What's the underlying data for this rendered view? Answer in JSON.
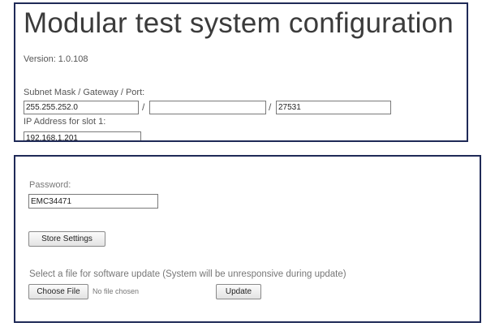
{
  "config": {
    "title": "Modular test system configuration",
    "version_text": "Version: 1.0.108",
    "network_label": "Subnet Mask / Gateway / Port:",
    "subnet_mask": "255.255.252.0",
    "separator": "/",
    "gateway": "",
    "port": "27531",
    "ip_slot_label": "IP Address for slot 1:",
    "ip_slot_value": "192.168.1.201"
  },
  "settings": {
    "password_label": "Password:",
    "password_value": "EMC34471",
    "store_button": "Store Settings",
    "update_label": "Select a file for software update (System will be unresponsive during update)",
    "choose_file_button": "Choose File",
    "no_file_text": "No file chosen",
    "update_button": "Update"
  }
}
